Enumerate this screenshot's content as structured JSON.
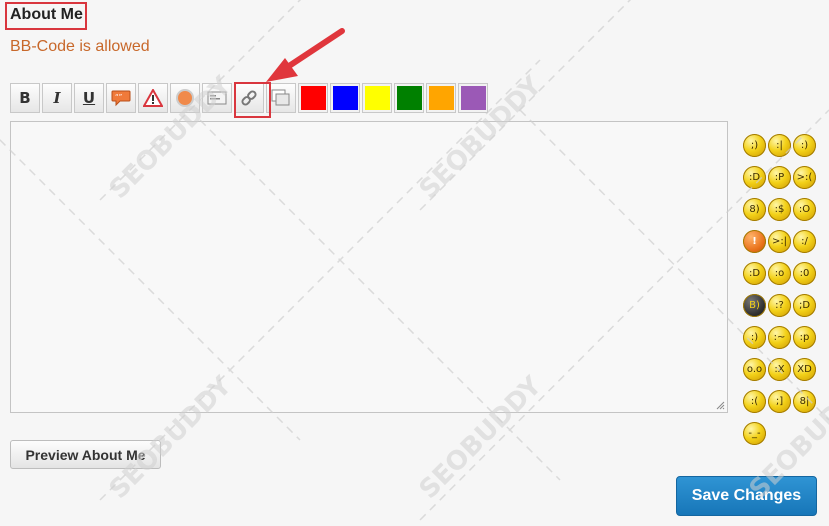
{
  "header": {
    "title": "About Me",
    "subtitle": "BB-Code is allowed"
  },
  "toolbar": {
    "buttons": [
      {
        "label": "B",
        "icon": "bold-icon"
      },
      {
        "label": "I",
        "icon": "italic-icon"
      },
      {
        "label": "U",
        "icon": "underline-icon"
      },
      {
        "label": "",
        "icon": "quote-bubble-icon"
      },
      {
        "label": "",
        "icon": "warning-icon"
      },
      {
        "label": "",
        "icon": "record-circle-icon"
      },
      {
        "label": "",
        "icon": "card-icon"
      },
      {
        "label": "",
        "icon": "link-chain-icon"
      },
      {
        "label": "",
        "icon": "image-icon"
      }
    ],
    "colors": [
      "#ff0000",
      "#0000ff",
      "#ffff00",
      "#008000",
      "#ffa500",
      "#9b59b6"
    ]
  },
  "editor": {
    "value": "",
    "placeholder": ""
  },
  "smileys": [
    "wink",
    "neutral",
    "smile",
    "grin",
    "tongue",
    "angry",
    "glasses",
    "blush",
    "shocked",
    "alert",
    "mad",
    "confused",
    "laugh",
    "surprised",
    "gasp",
    "cool",
    "thinking",
    "wink2",
    "sweat",
    "drool",
    "tongue2",
    "blink",
    "zipped",
    "lol",
    "sad",
    "smirk",
    "nerd",
    "sleepy"
  ],
  "actions": {
    "preview_label": "Preview About Me",
    "save_label": "Save Changes"
  },
  "colors": {
    "highlight": "#d9363e",
    "subtitle": "#c8682a",
    "save_button": "#1f82c4"
  }
}
